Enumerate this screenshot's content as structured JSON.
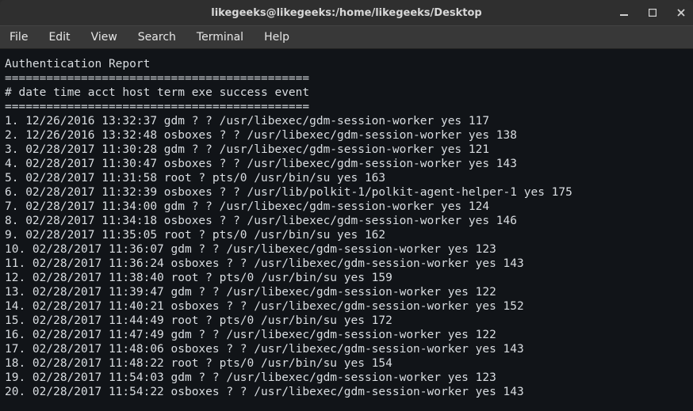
{
  "window": {
    "title": "likegeeks@likegeeks:/home/likegeeks/Desktop"
  },
  "menu": {
    "file": "File",
    "edit": "Edit",
    "view": "View",
    "search": "Search",
    "terminal": "Terminal",
    "help": "Help"
  },
  "report": {
    "title": "Authentication Report",
    "sep": "============================================",
    "header": "# date time acct host term exe success event",
    "rows": [
      {
        "n": 1,
        "date": "12/26/2016",
        "time": "13:32:37",
        "acct": "gdm",
        "host": "?",
        "term": "?",
        "exe": "/usr/libexec/gdm-session-worker",
        "success": "yes",
        "event": "117"
      },
      {
        "n": 2,
        "date": "12/26/2016",
        "time": "13:32:48",
        "acct": "osboxes",
        "host": "?",
        "term": "?",
        "exe": "/usr/libexec/gdm-session-worker",
        "success": "yes",
        "event": "138"
      },
      {
        "n": 3,
        "date": "02/28/2017",
        "time": "11:30:28",
        "acct": "gdm",
        "host": "?",
        "term": "?",
        "exe": "/usr/libexec/gdm-session-worker",
        "success": "yes",
        "event": "121"
      },
      {
        "n": 4,
        "date": "02/28/2017",
        "time": "11:30:47",
        "acct": "osboxes",
        "host": "?",
        "term": "?",
        "exe": "/usr/libexec/gdm-session-worker",
        "success": "yes",
        "event": "143"
      },
      {
        "n": 5,
        "date": "02/28/2017",
        "time": "11:31:58",
        "acct": "root",
        "host": "?",
        "term": "pts/0",
        "exe": "/usr/bin/su",
        "success": "yes",
        "event": "163"
      },
      {
        "n": 6,
        "date": "02/28/2017",
        "time": "11:32:39",
        "acct": "osboxes",
        "host": "?",
        "term": "?",
        "exe": "/usr/lib/polkit-1/polkit-agent-helper-1",
        "success": "yes",
        "event": "175"
      },
      {
        "n": 7,
        "date": "02/28/2017",
        "time": "11:34:00",
        "acct": "gdm",
        "host": "?",
        "term": "?",
        "exe": "/usr/libexec/gdm-session-worker",
        "success": "yes",
        "event": "124"
      },
      {
        "n": 8,
        "date": "02/28/2017",
        "time": "11:34:18",
        "acct": "osboxes",
        "host": "?",
        "term": "?",
        "exe": "/usr/libexec/gdm-session-worker",
        "success": "yes",
        "event": "146"
      },
      {
        "n": 9,
        "date": "02/28/2017",
        "time": "11:35:05",
        "acct": "root",
        "host": "?",
        "term": "pts/0",
        "exe": "/usr/bin/su",
        "success": "yes",
        "event": "162"
      },
      {
        "n": 10,
        "date": "02/28/2017",
        "time": "11:36:07",
        "acct": "gdm",
        "host": "?",
        "term": "?",
        "exe": "/usr/libexec/gdm-session-worker",
        "success": "yes",
        "event": "123"
      },
      {
        "n": 11,
        "date": "02/28/2017",
        "time": "11:36:24",
        "acct": "osboxes",
        "host": "?",
        "term": "?",
        "exe": "/usr/libexec/gdm-session-worker",
        "success": "yes",
        "event": "143"
      },
      {
        "n": 12,
        "date": "02/28/2017",
        "time": "11:38:40",
        "acct": "root",
        "host": "?",
        "term": "pts/0",
        "exe": "/usr/bin/su",
        "success": "yes",
        "event": "159"
      },
      {
        "n": 13,
        "date": "02/28/2017",
        "time": "11:39:47",
        "acct": "gdm",
        "host": "?",
        "term": "?",
        "exe": "/usr/libexec/gdm-session-worker",
        "success": "yes",
        "event": "122"
      },
      {
        "n": 14,
        "date": "02/28/2017",
        "time": "11:40:21",
        "acct": "osboxes",
        "host": "?",
        "term": "?",
        "exe": "/usr/libexec/gdm-session-worker",
        "success": "yes",
        "event": "152"
      },
      {
        "n": 15,
        "date": "02/28/2017",
        "time": "11:44:49",
        "acct": "root",
        "host": "?",
        "term": "pts/0",
        "exe": "/usr/bin/su",
        "success": "yes",
        "event": "172"
      },
      {
        "n": 16,
        "date": "02/28/2017",
        "time": "11:47:49",
        "acct": "gdm",
        "host": "?",
        "term": "?",
        "exe": "/usr/libexec/gdm-session-worker",
        "success": "yes",
        "event": "122"
      },
      {
        "n": 17,
        "date": "02/28/2017",
        "time": "11:48:06",
        "acct": "osboxes",
        "host": "?",
        "term": "?",
        "exe": "/usr/libexec/gdm-session-worker",
        "success": "yes",
        "event": "143"
      },
      {
        "n": 18,
        "date": "02/28/2017",
        "time": "11:48:22",
        "acct": "root",
        "host": "?",
        "term": "pts/0",
        "exe": "/usr/bin/su",
        "success": "yes",
        "event": "154"
      },
      {
        "n": 19,
        "date": "02/28/2017",
        "time": "11:54:03",
        "acct": "gdm",
        "host": "?",
        "term": "?",
        "exe": "/usr/libexec/gdm-session-worker",
        "success": "yes",
        "event": "123"
      },
      {
        "n": 20,
        "date": "02/28/2017",
        "time": "11:54:22",
        "acct": "osboxes",
        "host": "?",
        "term": "?",
        "exe": "/usr/libexec/gdm-session-worker",
        "success": "yes",
        "event": "143"
      }
    ]
  }
}
